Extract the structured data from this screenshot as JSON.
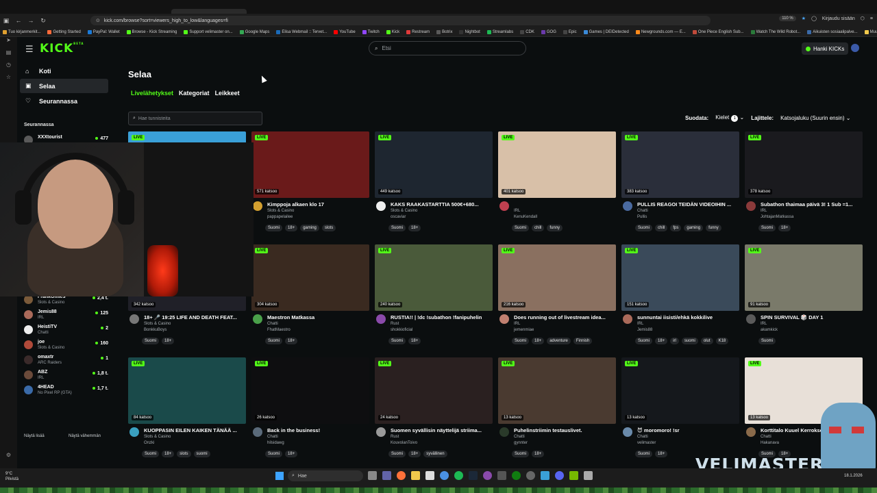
{
  "browser": {
    "url": "kick.com/browse?sort=viewers_high_to_low&languages=fi",
    "zoom": "110 %",
    "signin": "Kirjaudu sisään",
    "bookmarks": [
      "Tuo kirjanmerkit...",
      "Getting Started",
      "PayPal: Wallet",
      "Browse - Kick Streaming",
      "Support velimaster on...",
      "Google Maps",
      "Elisa Webmail :: Tervet...",
      "YouTube",
      "Twitch",
      "Kick",
      "Restream",
      "Botrix",
      "Nightbot",
      "Streamlabs",
      "CDK",
      "GOG",
      "Epic",
      "Games | DEIDetected",
      "Newgrounds.com — E...",
      "One Piece English Sub...",
      "Watch The Wild Robot...",
      "Aikuisten sosiaalipalve...",
      "Muut kirjanmerkit"
    ]
  },
  "topnav": {
    "logo": "KICK",
    "logo_sup": "BETA",
    "search_placeholder": "Etsi",
    "kicks_button": "Hanki KICKs"
  },
  "sidebar": {
    "nav": [
      {
        "label": "Koti",
        "icon": "home-icon"
      },
      {
        "label": "Selaa",
        "icon": "browse-icon"
      },
      {
        "label": "Seurannassa",
        "icon": "heart-icon"
      }
    ],
    "section": "Seurannassa",
    "following": [
      {
        "name": "XXXtourist",
        "category": "",
        "viewers": "477",
        "color": "#5a5a5a"
      },
      {
        "name": "FrankOmies",
        "category": "Slots & Casino",
        "viewers": "2,4 t.",
        "color": "#7a5a3a"
      },
      {
        "name": "Jemis88",
        "category": "IRL",
        "viewers": "125",
        "color": "#aa6a5a"
      },
      {
        "name": "HeistiTV",
        "category": "Chatti",
        "viewers": "2",
        "color": "#eee"
      },
      {
        "name": "joe",
        "category": "Slots & Casino",
        "viewers": "160",
        "color": "#b04a3a"
      },
      {
        "name": "omaxtr",
        "category": "ARC Raiders",
        "viewers": "1",
        "color": "#3a2a2a"
      },
      {
        "name": "ABZ",
        "category": "IRL",
        "viewers": "1,8 t.",
        "color": "#6a4a3a"
      },
      {
        "name": "4HEAD",
        "category": "No Pixel RP (GTA)",
        "viewers": "1,7 t.",
        "color": "#3a6aa8"
      }
    ],
    "show_more": "Näytä lisää",
    "show_less": "Näytä vähemmän"
  },
  "main": {
    "title": "Selaa",
    "tabs": [
      "Livelähetykset",
      "Kategoriat",
      "Leikkeet"
    ],
    "tag_search_placeholder": "Hae tunnisteita",
    "filter_label": "Suodata:",
    "languages_label": "Kielet",
    "languages_count": "1",
    "sort_label": "Lajittele:",
    "sort_value": "Katsojaluku (Suurin ensin)"
  },
  "live_label": "LIVE",
  "streams": [
    {
      "title": "",
      "category": "",
      "streamer": "",
      "viewers": "",
      "tags": [],
      "thumb": "#3aa0d8",
      "avatar": "#888"
    },
    {
      "title": "Kimppoja alkaen klo 17",
      "category": "Slots & Casino",
      "streamer": "pappapelailee",
      "viewers": "571 katsoo",
      "tags": [
        "Suomi",
        "18+",
        "gaming",
        "slots"
      ],
      "thumb": "#6a1a1a",
      "avatar": "#d4a030"
    },
    {
      "title": "KAKS RAAKASTARTTIA 500€+680...",
      "category": "Slots & Casino",
      "streamer": "oscaviar",
      "viewers": "449 katsoo",
      "tags": [
        "Suomi",
        "18+"
      ],
      "thumb": "#1e2630",
      "avatar": "#eee"
    },
    {
      "title": "",
      "category": "IRL",
      "streamer": "KenuKendall",
      "viewers": "401 katsoo",
      "tags": [
        "Suomi",
        "chill",
        "funny"
      ],
      "thumb": "#d8c0a8",
      "avatar": "#c04050"
    },
    {
      "title": "PULLIS REAGOI TEIDÄN VIDEOIHIN ...",
      "category": "Chatti",
      "streamer": "Pullis",
      "viewers": "383 katsoo",
      "tags": [
        "Suomi",
        "chill",
        "fps",
        "gaming",
        "funny"
      ],
      "thumb": "#2a2e3a",
      "avatar": "#4a6aa0"
    },
    {
      "title": "Subathon thaimaa päivä 3! 1 Sub =1...",
      "category": "IRL",
      "streamer": "JohtajanMatkassa",
      "viewers": "378 katsoo",
      "tags": [
        "Suomi",
        "18+"
      ],
      "thumb": "#1a1a1e",
      "avatar": "#8a3a3a"
    },
    {
      "title": "18+ 🎤 19:25 LIFE AND DEATH FEAT...",
      "category": "Slots & Casino",
      "streamer": "BonkkuBoys",
      "viewers": "342 katsoo",
      "tags": [
        "Suomi",
        "18+"
      ],
      "thumb": "#202028",
      "avatar": "#777"
    },
    {
      "title": "Maestron Matkassa",
      "category": "Chatti",
      "streamer": "FhatMaestro",
      "viewers": "304 katsoo",
      "tags": [
        "Suomi",
        "18+"
      ],
      "thumb": "#3a2a20",
      "avatar": "#4aa04a"
    },
    {
      "title": "RUSTIA!! | !dc !subathon !fanipuhelin",
      "category": "Rust",
      "streamer": "shokkioficial",
      "viewers": "240 katsoo",
      "tags": [
        "Suomi",
        "18+"
      ],
      "thumb": "#4a5a3a",
      "avatar": "#8a4aaa"
    },
    {
      "title": "Does running out of livestream idea...",
      "category": "IRL",
      "streamer": "jemenmiae",
      "viewers": "216 katsoo",
      "tags": [
        "Suomi",
        "18+",
        "adventure",
        "Finnish"
      ],
      "thumb": "#8a7060",
      "avatar": "#c08070"
    },
    {
      "title": "sunnuntai iisisti/ehkä kokkilive",
      "category": "IRL",
      "streamer": "Jemis88",
      "viewers": "151 katsoo",
      "tags": [
        "Suomi",
        "18+",
        "irl",
        "suomi",
        "olut",
        "K18"
      ],
      "thumb": "#3a4a5a",
      "avatar": "#aa6a5a"
    },
    {
      "title": "SPIN SURVIVAL 🎲 DAY 1",
      "category": "IRL",
      "streamer": "akamkick",
      "viewers": "91 katsoo",
      "tags": [
        "Suomi"
      ],
      "thumb": "#7a7a6a",
      "avatar": "#5a5a5a"
    },
    {
      "title": "KUOPPASIN EILEN KAIKEN TÄNÄÄ ...",
      "category": "Slots & Casino",
      "streamer": "Onzki",
      "viewers": "84 katsoo",
      "tags": [
        "Suomi",
        "18+",
        "slots",
        "suomi"
      ],
      "thumb": "#1a4a4a",
      "avatar": "#3aa0c0"
    },
    {
      "title": "Back in the business!",
      "category": "Chatti",
      "streamer": "hilsidawg",
      "viewers": "26 katsoo",
      "tags": [
        "Suomi",
        "18+"
      ],
      "thumb": "#0e0e10",
      "avatar": "#5a6a7a"
    },
    {
      "title": "Suomen syvällisin näyttelijä striima...",
      "category": "Rust",
      "streamer": "KouvolanToivo",
      "viewers": "24 katsoo",
      "tags": [
        "Suomi",
        "18+",
        "syvällinen"
      ],
      "thumb": "#2a2020",
      "avatar": "#9a9a9a"
    },
    {
      "title": "Puhelinstriimin testauslivet.",
      "category": "Chatti",
      "streamer": "gynnter",
      "viewers": "13 katsoo",
      "tags": [
        "Suomi",
        "18+"
      ],
      "thumb": "#4a3a30",
      "avatar": "#2a3a2a"
    },
    {
      "title": "😈 moromoro! !sr",
      "category": "Chatti",
      "streamer": "velimaster",
      "viewers": "13 katsoo",
      "tags": [
        "Suomi",
        "18+"
      ],
      "thumb": "#15181c",
      "avatar": "#6a8aaa"
    },
    {
      "title": "Korttitalo Kuuel Kerroksella",
      "category": "Chatti",
      "streamer": "Hakanava",
      "viewers": "13 katsoo",
      "tags": [
        "Suomi",
        "18+"
      ],
      "thumb": "#e8e0d8",
      "avatar": "#8a6a4a"
    }
  ],
  "overlay": {
    "brand": "VELIMASTER"
  },
  "taskbar": {
    "weather_temp": "9°C",
    "weather_desc": "Pilvistä",
    "search": "Hae",
    "date": "18.1.2026"
  }
}
